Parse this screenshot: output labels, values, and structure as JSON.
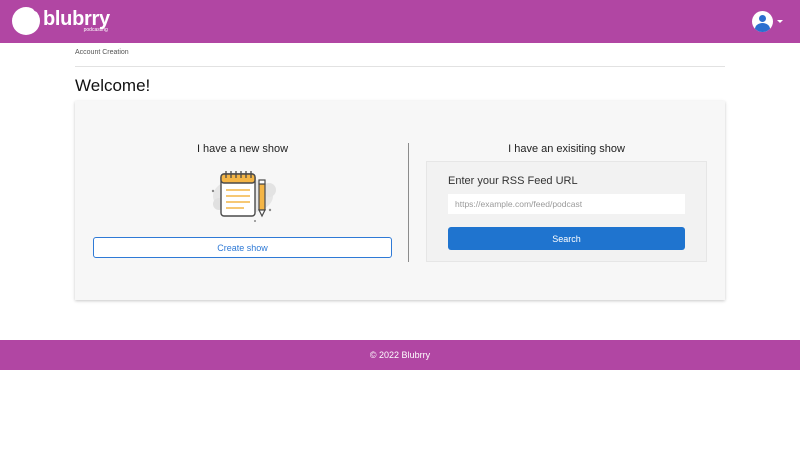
{
  "header": {
    "brand": "blubrry",
    "brand_tagline": "podcasting",
    "user_icon": "user-circle-icon",
    "accent_color": "#b146a3"
  },
  "breadcrumb": "Account Creation",
  "page_title": "Welcome!",
  "new_show": {
    "title": "I have a new show",
    "illustration_icon": "notepad-pencil-icon",
    "button_label": "Create show"
  },
  "existing_show": {
    "title": "I have an exisiting show",
    "rss_label": "Enter your RSS Feed URL",
    "rss_placeholder": "https://example.com/feed/podcast",
    "rss_value": "",
    "search_label": "Search",
    "button_color": "#1f74cf"
  },
  "footer": {
    "copyright": "© 2022 Blubrry"
  }
}
